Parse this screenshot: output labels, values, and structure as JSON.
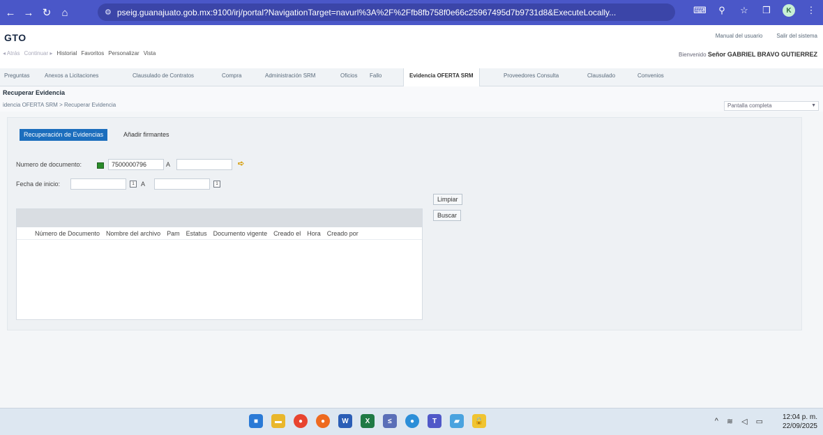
{
  "browser": {
    "url": "pseig.guanajuato.gob.mx:9100/irj/portal?NavigationTarget=navurl%3A%2F%2Ffb8fb758f0e66c25967495d7b9731d8&ExecuteLocally...",
    "profile_initial": "K"
  },
  "portal": {
    "logo": "GTO",
    "manual_link": "Manual del usuario",
    "logout_link": "Salir del sistema",
    "history": {
      "back": "◂ Atrás",
      "forward": "Continuar ▸",
      "items": [
        "Historial",
        "Favoritos",
        "Personalizar",
        "Vista"
      ]
    },
    "welcome_prefix": "Bienvenido",
    "user": "Señor GABRIEL BRAVO GUTIERREZ"
  },
  "tabs": [
    "Preguntas",
    "Anexos a Licitaciones",
    "Clausulado de Contratos",
    "Compra",
    "Administración SRM",
    "Oficios",
    "Fallo",
    "Evidencia OFERTA SRM",
    "Proveedores Consulta",
    "Clausulado",
    "Convenios"
  ],
  "active_tab": "Evidencia OFERTA SRM",
  "page": {
    "title": "Recuperar Evidencia",
    "breadcrumb": "idencia OFERTA SRM  >  Recuperar Evidencia",
    "fullscreen_select": "Pantalla completa"
  },
  "form": {
    "subtabs": [
      "Recuperación de Evidencias",
      "Añadir firmantes"
    ],
    "doc_number_label": "Numero de documento:",
    "doc_number_from": "7500000796",
    "doc_number_to": "",
    "range_sep": "A",
    "start_date_label": "Fecha de inicio:",
    "start_date_from": "",
    "start_date_to": "",
    "calendar_glyph": "1",
    "clear_button": "Limpiar",
    "search_button": "Buscar"
  },
  "results": {
    "columns": [
      "Número de Documento",
      "Nombre del archivo",
      "Pam",
      "Estatus",
      "Documento vigente",
      "Creado el",
      "Hora",
      "Creado por"
    ],
    "rows": []
  },
  "taskbar": {
    "time": "12:04 p. m.",
    "date": "22/09/2025"
  }
}
